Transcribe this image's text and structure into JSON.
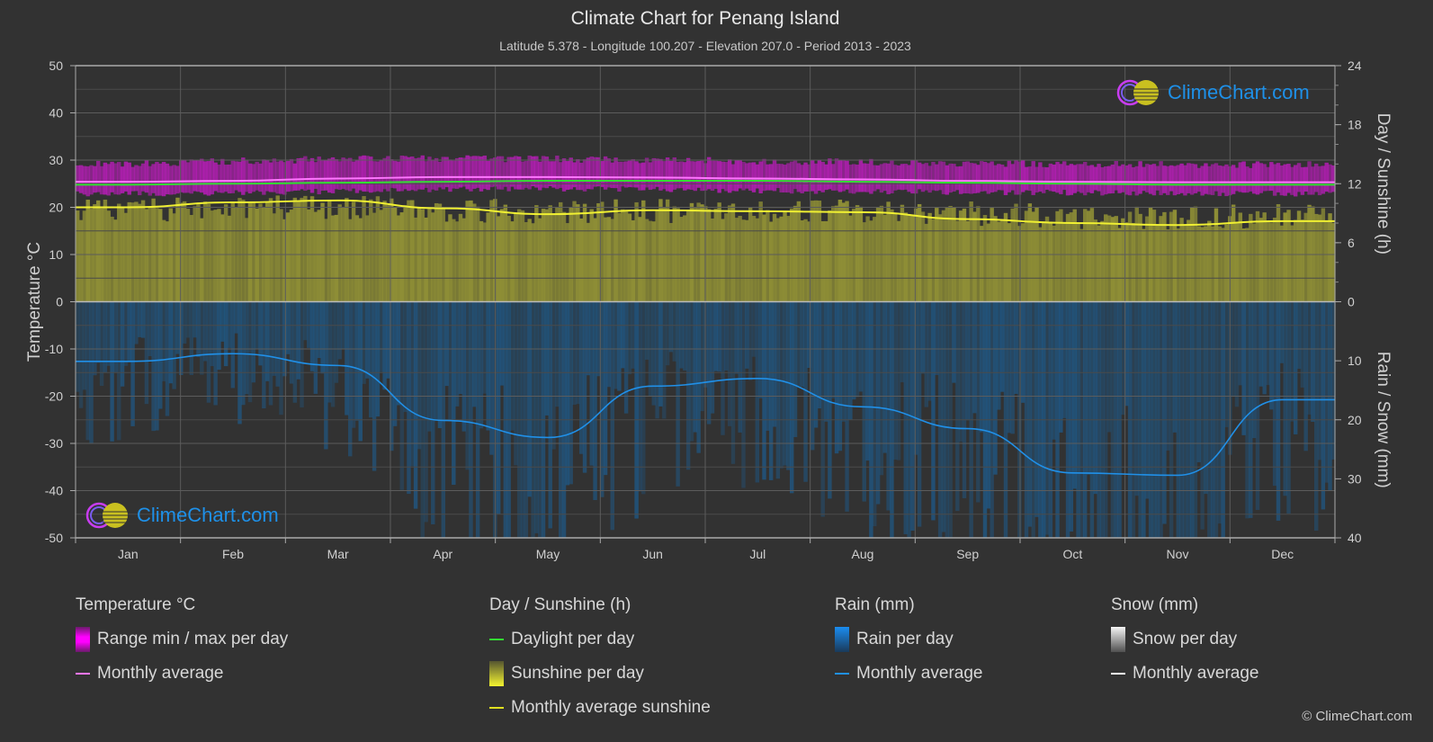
{
  "header": {
    "title": "Climate Chart for Penang Island",
    "subtitle": "Latitude 5.378 - Longitude 100.207 - Elevation 207.0 - Period 2013 - 2023"
  },
  "logo_text": "ClimeChart.com",
  "copyright": "© ClimeChart.com",
  "colors": {
    "background": "#323232",
    "temp_range": "#c21cc2",
    "temp_avg": "#ff77ff",
    "daylight": "#33dd33",
    "sunshine_fill": "#8f8f36",
    "sunshine_avg": "#f0f032",
    "rain_fill": "#1e5a8a",
    "rain_avg": "#2090e8",
    "snow_avg": "#ffffff",
    "logo_text": "#1e90e8"
  },
  "chart_data": {
    "type": "line",
    "title": "Climate Chart for Penang Island",
    "categories": [
      "Jan",
      "Feb",
      "Mar",
      "Apr",
      "May",
      "Jun",
      "Jul",
      "Aug",
      "Sep",
      "Oct",
      "Nov",
      "Dec"
    ],
    "left_axis": {
      "label": "Temperature °C",
      "range": [
        -50,
        50
      ],
      "ticks": [
        50,
        40,
        30,
        20,
        10,
        0,
        -10,
        -20,
        -30,
        -40,
        -50
      ]
    },
    "right_axis_top": {
      "label": "Day / Sunshine (h)",
      "range": [
        0,
        24
      ],
      "ticks": [
        24,
        18,
        12,
        6,
        0
      ]
    },
    "right_axis_bottom": {
      "label": "Rain / Snow (mm)",
      "range": [
        0,
        40
      ],
      "ticks": [
        0,
        10,
        20,
        30,
        40
      ]
    },
    "grid": true,
    "series": [
      {
        "name": "Temperature range min",
        "axis": "temp",
        "values": [
          23.5,
          23.6,
          24.0,
          24.4,
          24.5,
          24.4,
          24.1,
          24.0,
          23.8,
          23.7,
          23.6,
          23.5
        ]
      },
      {
        "name": "Temperature range max",
        "axis": "temp",
        "values": [
          28.5,
          29.0,
          29.5,
          29.6,
          29.5,
          29.3,
          29.0,
          28.9,
          28.6,
          28.4,
          28.3,
          28.3
        ]
      },
      {
        "name": "Temperature monthly average",
        "axis": "temp",
        "values": [
          25.4,
          25.6,
          26.1,
          26.4,
          26.4,
          26.3,
          26.1,
          25.9,
          25.6,
          25.4,
          25.3,
          25.3
        ]
      },
      {
        "name": "Daylight per day",
        "axis": "sun",
        "values": [
          11.9,
          12.0,
          12.1,
          12.2,
          12.3,
          12.3,
          12.3,
          12.2,
          12.1,
          12.0,
          11.9,
          11.9
        ]
      },
      {
        "name": "Sunshine monthly average",
        "axis": "sun",
        "values": [
          9.6,
          10.1,
          10.3,
          9.5,
          8.9,
          9.3,
          9.2,
          9.1,
          8.4,
          8.0,
          7.8,
          8.2
        ]
      },
      {
        "name": "Sunshine per day",
        "axis": "sun",
        "values": [
          10.5,
          10.8,
          10.8,
          10.6,
          10.4,
          10.5,
          10.3,
          10.4,
          10.2,
          9.9,
          9.8,
          10.0
        ]
      },
      {
        "name": "Rain monthly average",
        "axis": "rain",
        "values": [
          10.1,
          8.8,
          10.8,
          20.1,
          23.0,
          14.3,
          13.0,
          17.8,
          21.5,
          29.0,
          29.4,
          16.6
        ]
      },
      {
        "name": "Snow monthly average",
        "axis": "rain",
        "values": [
          0,
          0,
          0,
          0,
          0,
          0,
          0,
          0,
          0,
          0,
          0,
          0
        ]
      }
    ]
  },
  "legend": {
    "temperature": {
      "title": "Temperature °C",
      "items": [
        "Range min / max per day",
        "Monthly average"
      ]
    },
    "sunshine": {
      "title": "Day / Sunshine (h)",
      "items": [
        "Daylight per day",
        "Sunshine per day",
        "Monthly average sunshine"
      ]
    },
    "rain": {
      "title": "Rain (mm)",
      "items": [
        "Rain per day",
        "Monthly average"
      ]
    },
    "snow": {
      "title": "Snow (mm)",
      "items": [
        "Snow per day",
        "Monthly average"
      ]
    }
  }
}
